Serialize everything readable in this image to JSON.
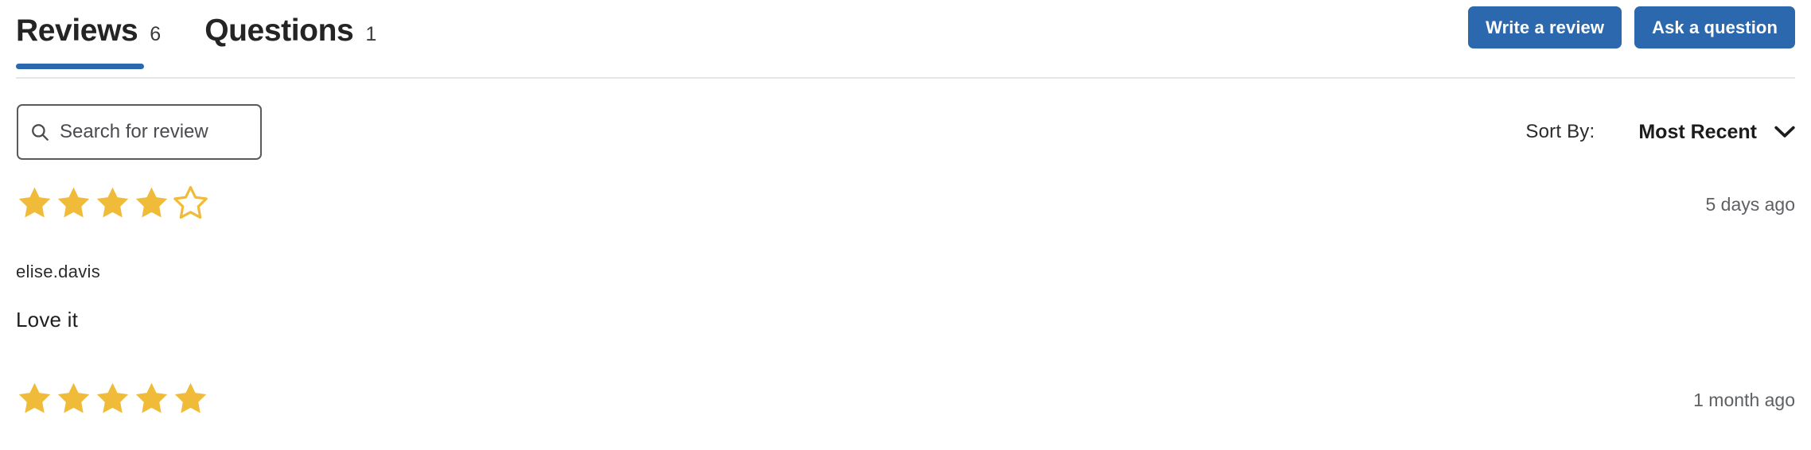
{
  "header": {
    "tabs": [
      {
        "label": "Reviews",
        "count": "6",
        "active": true
      },
      {
        "label": "Questions",
        "count": "1",
        "active": false
      }
    ],
    "actions": [
      {
        "label": "Write a review",
        "name": "write-a-review-button"
      },
      {
        "label": "Ask a question",
        "name": "ask-a-question-button"
      }
    ]
  },
  "filters": {
    "search_placeholder": "Search for review",
    "search_value": "",
    "sort_label": "Sort By:",
    "sort_value": "Most Recent",
    "sort_options": [
      "Most Recent"
    ]
  },
  "reviews": [
    {
      "rating": 4,
      "max_rating": 5,
      "time": "5 days ago",
      "author": "elise.davis",
      "body": "Love it"
    },
    {
      "rating": 5,
      "max_rating": 5,
      "time": "1 month ago",
      "author": "",
      "body": ""
    }
  ],
  "colors": {
    "accent_blue": "#2c68ae",
    "star_gold": "#efbb39",
    "divider": "#e6e6e8",
    "text_primary": "#242424",
    "text_muted": "#5e6063"
  }
}
